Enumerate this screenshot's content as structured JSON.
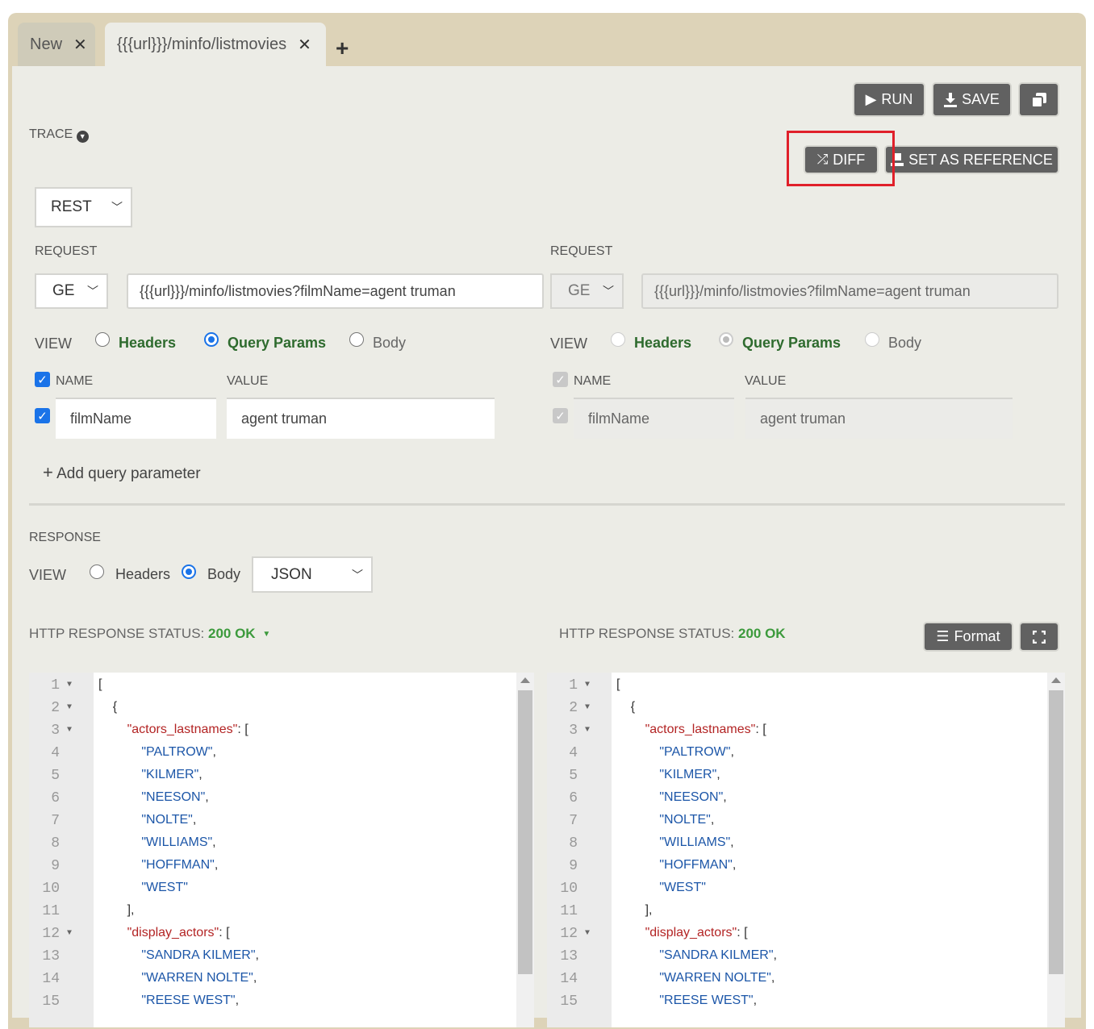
{
  "tabs": [
    {
      "label": "New"
    },
    {
      "label": "{{{url}}}/minfo/listmovies"
    }
  ],
  "toolbar": {
    "run_label": "RUN",
    "save_label": "SAVE",
    "diff_label": "DIFF",
    "set_reference_label": "SET AS REFERENCE",
    "format_label": "Format"
  },
  "trace_label": "TRACE",
  "protocol": "REST",
  "left": {
    "request_label": "REQUEST",
    "method": "GE",
    "url": "{{{url}}}/minfo/listmovies?filmName=agent truman",
    "view_label": "VIEW",
    "view_options": [
      "Headers",
      "Query Params",
      "Body"
    ],
    "params_header": {
      "name": "NAME",
      "value": "VALUE"
    },
    "param": {
      "name": "filmName",
      "value": "agent truman"
    },
    "add_param_label": "Add query parameter"
  },
  "right": {
    "request_label": "REQUEST",
    "method": "GE",
    "url": "{{{url}}}/minfo/listmovies?filmName=agent truman",
    "view_label": "VIEW",
    "view_options": [
      "Headers",
      "Query Params",
      "Body"
    ],
    "params_header": {
      "name": "NAME",
      "value": "VALUE"
    },
    "param": {
      "name": "filmName",
      "value": "agent truman"
    }
  },
  "response": {
    "label": "RESPONSE",
    "view_label": "VIEW",
    "view_options": [
      "Headers",
      "Body"
    ],
    "format_select": "JSON",
    "status_label": "HTTP RESPONSE STATUS:",
    "status_value": "200 OK"
  },
  "code_lines": [
    {
      "n": "1",
      "fold": true,
      "text": "["
    },
    {
      "n": "2",
      "fold": true,
      "text": "    {"
    },
    {
      "n": "3",
      "fold": true,
      "key": "\"actors_lastnames\"",
      "rest": ": ["
    },
    {
      "n": "4",
      "fold": false,
      "str": "\"PALTROW\"",
      "rest": ","
    },
    {
      "n": "5",
      "fold": false,
      "str": "\"KILMER\"",
      "rest": ","
    },
    {
      "n": "6",
      "fold": false,
      "str": "\"NEESON\"",
      "rest": ","
    },
    {
      "n": "7",
      "fold": false,
      "str": "\"NOLTE\"",
      "rest": ","
    },
    {
      "n": "8",
      "fold": false,
      "str": "\"WILLIAMS\"",
      "rest": ","
    },
    {
      "n": "9",
      "fold": false,
      "str": "\"HOFFMAN\"",
      "rest": ","
    },
    {
      "n": "10",
      "fold": false,
      "str": "\"WEST\"",
      "rest": ""
    },
    {
      "n": "11",
      "fold": false,
      "text": "        ],"
    },
    {
      "n": "12",
      "fold": true,
      "key": "\"display_actors\"",
      "rest": ": ["
    },
    {
      "n": "13",
      "fold": false,
      "str": "\"SANDRA KILMER\"",
      "rest": ","
    },
    {
      "n": "14",
      "fold": false,
      "str": "\"WARREN NOLTE\"",
      "rest": ","
    },
    {
      "n": "15",
      "fold": false,
      "str": "\"REESE WEST\"",
      "rest": ","
    }
  ],
  "colors": {
    "accent": "#1a73e8",
    "ok": "#3c9a3c",
    "button": "#616161",
    "highlight": "#e0202a"
  }
}
